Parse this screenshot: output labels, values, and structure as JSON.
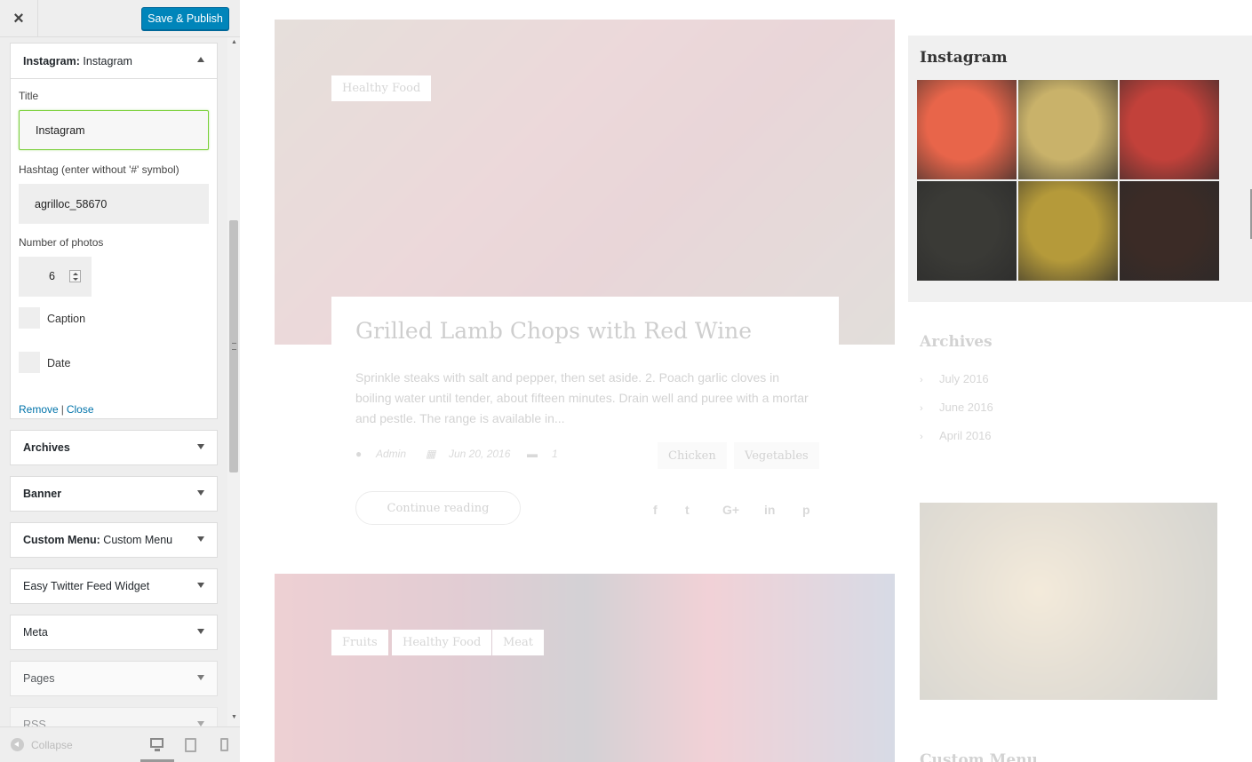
{
  "customizer": {
    "close_label": "×",
    "save_label": "Save & Publish",
    "instagram_widget": {
      "head_prefix": "Instagram:",
      "head_title": "Instagram",
      "title_label": "Title",
      "title_value": "Instagram",
      "hashtag_label": "Hashtag (enter without '#' symbol)",
      "hashtag_value": "agrilloc_58670",
      "photos_label": "Number of photos",
      "photos_value": "6",
      "caption_label": "Caption",
      "date_label": "Date",
      "remove_link": "Remove",
      "separator": "|",
      "close_link": "Close"
    },
    "widgets": [
      {
        "name": "Archives",
        "sub": ""
      },
      {
        "name": "Banner",
        "sub": ""
      },
      {
        "name": "Custom Menu:",
        "sub": "Custom Menu"
      },
      {
        "name": "Easy Twitter Feed Widget",
        "sub": ""
      },
      {
        "name": "Meta",
        "sub": ""
      },
      {
        "name": "Pages",
        "sub": ""
      },
      {
        "name": "RSS",
        "sub": ""
      }
    ],
    "footer": {
      "collapse_label": "Collapse"
    }
  },
  "preview": {
    "post1": {
      "tag": "Healthy Food",
      "title": "Grilled Lamb Chops with Red Wine",
      "excerpt": "Sprinkle steaks with salt and pepper, then set aside. 2. Poach garlic cloves in boiling water until tender, about fifteen minutes. Drain well and puree with a mortar and pestle. The range is available in...",
      "author": "Admin",
      "date": "Jun 20, 2016",
      "comments": "1",
      "categories": [
        "Chicken",
        "Vegetables"
      ],
      "continue_label": "Continue reading",
      "share_icons": [
        "f",
        "t",
        "G+",
        "in",
        "p"
      ]
    },
    "post2": {
      "tags": [
        "Fruits",
        "Healthy Food",
        "Meat"
      ]
    },
    "instagram": {
      "title": "Instagram",
      "photos": [
        {
          "name": "salmon",
          "color": "#e8654a"
        },
        {
          "name": "noodles",
          "color": "#c9b26a"
        },
        {
          "name": "shrimp",
          "color": "#c2413a"
        },
        {
          "name": "egg",
          "color": "#3a3a36"
        },
        {
          "name": "juice",
          "color": "#b59a3a"
        },
        {
          "name": "steak",
          "color": "#3b2b26"
        }
      ]
    },
    "archives": {
      "title": "Archives",
      "items": [
        "July 2016",
        "June 2016",
        "April 2016"
      ]
    },
    "next_widget_title": "Custom Menu"
  }
}
